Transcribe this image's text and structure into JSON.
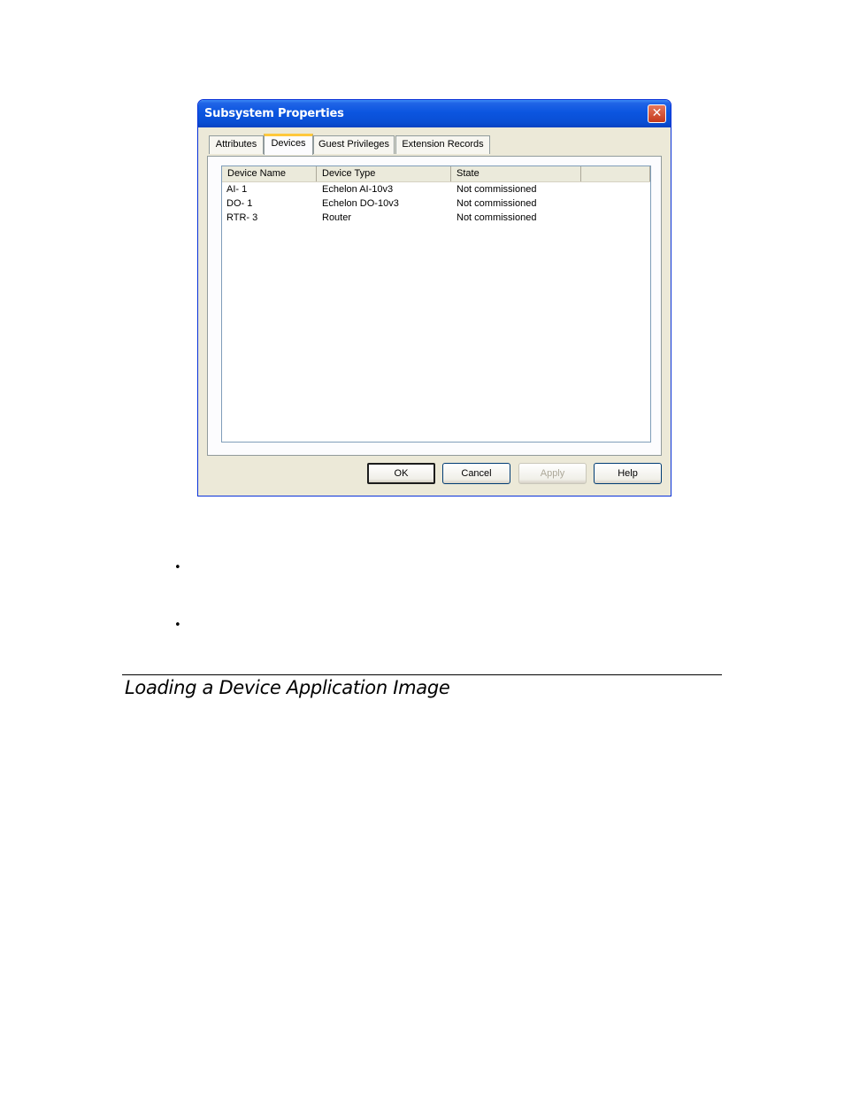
{
  "dialog": {
    "title": "Subsystem Properties",
    "close_glyph": "✕",
    "tabs": [
      {
        "label": "Attributes",
        "active": false
      },
      {
        "label": "Devices",
        "active": true
      },
      {
        "label": "Guest Privileges",
        "active": false
      },
      {
        "label": "Extension Records",
        "active": false
      }
    ],
    "columns": [
      "Device Name",
      "Device Type",
      "State",
      ""
    ],
    "rows": [
      {
        "name": "AI- 1",
        "type": "Echelon AI-10v3",
        "state": "Not commissioned"
      },
      {
        "name": "DO- 1",
        "type": "Echelon DO-10v3",
        "state": "Not commissioned"
      },
      {
        "name": "RTR- 3",
        "type": "Router",
        "state": "Not commissioned"
      }
    ],
    "buttons": {
      "ok": "OK",
      "cancel": "Cancel",
      "apply": "Apply",
      "help": "Help"
    }
  },
  "document": {
    "bullet_glyph": "•",
    "heading": "Loading a Device Application Image"
  },
  "colors": {
    "titlebar": "#0a4fd4",
    "close": "#c43a1c",
    "active_tab_accent": "#ffc83c"
  }
}
